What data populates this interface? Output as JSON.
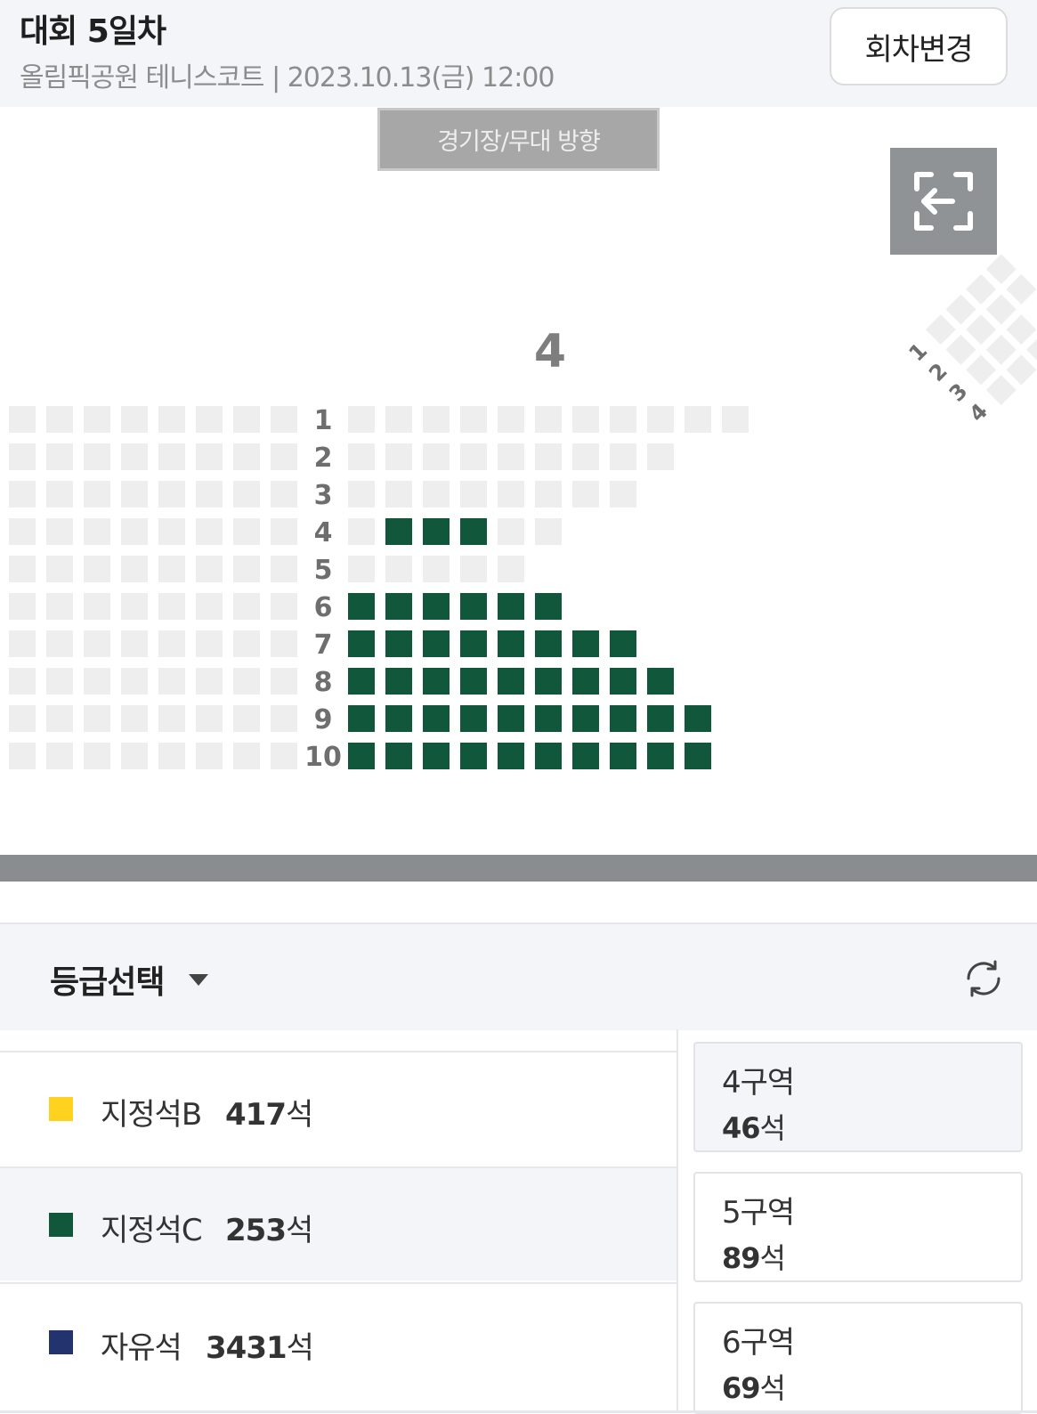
{
  "header": {
    "title": "대회 5일차",
    "subtitle": "올림픽공원 테니스코트 | 2023.10.13(금) 12:00",
    "change_label": "회차변경"
  },
  "stage_label": "경기장/무대 방향",
  "section_label": "4",
  "row_labels": [
    "1",
    "2",
    "3",
    "4",
    "5",
    "6",
    "7",
    "8",
    "9",
    "10"
  ],
  "side_row_labels": [
    "1",
    "2",
    "3",
    "4"
  ],
  "colors": {
    "available": "#11573c",
    "unavailable": "#eeeeee",
    "grade_b": "#ffd21f",
    "grade_c": "#11573c",
    "grade_free": "#22336e"
  },
  "seat_rows": [
    {
      "row": "1",
      "left_count": 8,
      "right_count": 11,
      "available_idx": []
    },
    {
      "row": "2",
      "left_count": 8,
      "right_count": 9,
      "available_idx": []
    },
    {
      "row": "3",
      "left_count": 8,
      "right_count": 8,
      "available_idx": []
    },
    {
      "row": "4",
      "left_count": 8,
      "right_count": 6,
      "available_idx": [
        1,
        2,
        3
      ]
    },
    {
      "row": "5",
      "left_count": 8,
      "right_count": 5,
      "available_idx": []
    },
    {
      "row": "6",
      "left_count": 8,
      "right_count": 6,
      "available_idx": [
        0,
        1,
        2,
        3,
        4,
        5
      ]
    },
    {
      "row": "7",
      "left_count": 8,
      "right_count": 8,
      "available_idx": [
        0,
        1,
        2,
        3,
        4,
        5,
        6,
        7
      ]
    },
    {
      "row": "8",
      "left_count": 8,
      "right_count": 9,
      "available_idx": [
        0,
        1,
        2,
        3,
        4,
        5,
        6,
        7,
        8
      ]
    },
    {
      "row": "9",
      "left_count": 8,
      "right_count": 10,
      "available_idx": [
        0,
        1,
        2,
        3,
        4,
        5,
        6,
        7,
        8,
        9
      ]
    },
    {
      "row": "10",
      "left_count": 8,
      "right_count": 10,
      "available_idx": [
        0,
        1,
        2,
        3,
        4,
        5,
        6,
        7,
        8,
        9
      ]
    }
  ],
  "grade_select": {
    "title": "등급선택",
    "grades": [
      {
        "name": "지정석B",
        "count": "417",
        "unit": "석"
      },
      {
        "name": "지정석C",
        "count": "253",
        "unit": "석"
      },
      {
        "name": "자유석",
        "count": "3431",
        "unit": "석"
      }
    ]
  },
  "zones": [
    {
      "name": "4구역",
      "count": "46",
      "unit": "석"
    },
    {
      "name": "5구역",
      "count": "89",
      "unit": "석"
    },
    {
      "name": "6구역",
      "count": "69",
      "unit": "석"
    }
  ]
}
